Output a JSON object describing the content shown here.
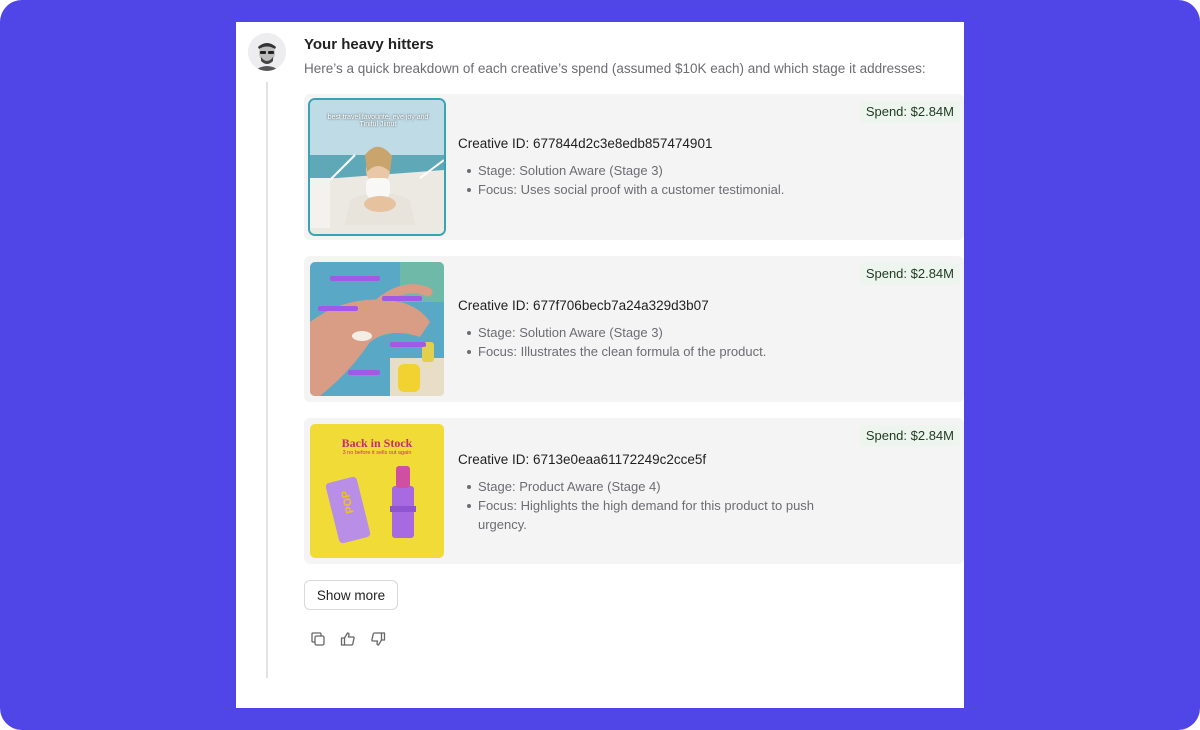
{
  "header": {
    "title": "Your heavy hitters",
    "subtitle": "Here’s a quick breakdown of each creative’s spend (assumed $10K each) and which stage it addresses:"
  },
  "creatives": [
    {
      "id_label": "Creative ID: 677844d2c3e8edb857474901",
      "stage": "Stage: Solution Aware (Stage 3)",
      "focus": "Focus: Uses social proof with a customer testimonial.",
      "spend": "Spend: $2.84M",
      "thumb_caption": "best travel favourite. eve joy and Tiniful Jiinut"
    },
    {
      "id_label": "Creative ID: 677f706becb7a24a329d3b07",
      "stage": "Stage: Solution Aware (Stage 3)",
      "focus": "Focus: Illustrates the clean formula of the product.",
      "spend": "Spend: $2.84M"
    },
    {
      "id_label": "Creative ID: 6713e0eaa61172249c2cce5f",
      "stage": "Stage: Product Aware (Stage 4)",
      "focus": "Focus: Highlights the high demand for this product to push urgency.",
      "spend": "Spend: $2.84M",
      "thumb_title": "Back in Stock",
      "thumb_subtitle": "3 no before it sells out again",
      "thumb_box_text": "POP"
    }
  ],
  "show_more_label": "Show more",
  "actions": [
    "copy-icon",
    "thumbs-up-icon",
    "thumbs-down-icon"
  ],
  "colors": {
    "frame_background": "#5046e8",
    "card_background": "#f4f4f5",
    "spend_badge_background": "#eef4ee",
    "selected_outline": "#3aa3b3"
  }
}
